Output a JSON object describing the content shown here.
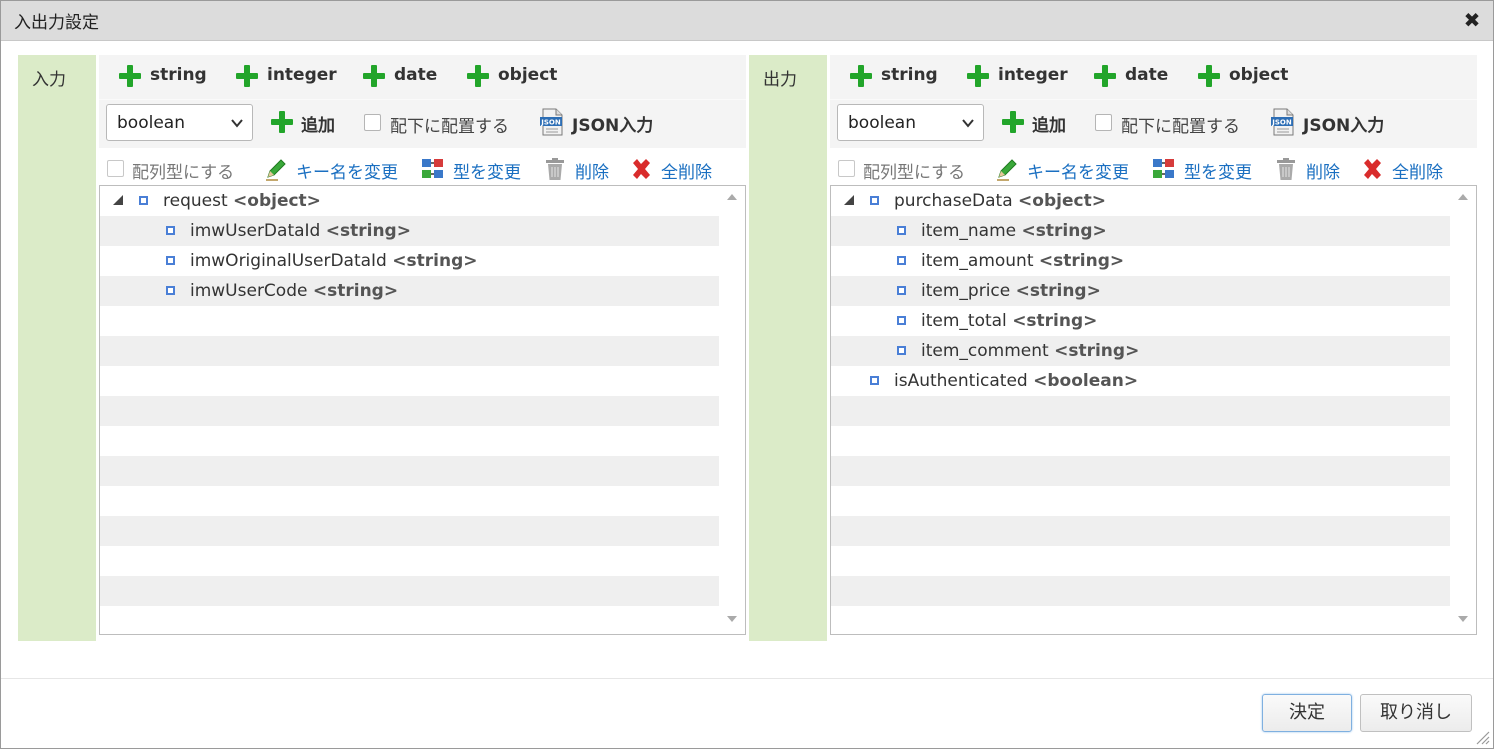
{
  "dialog": {
    "title": "入出力設定"
  },
  "input": {
    "section_label": "入力",
    "type_buttons": [
      "string",
      "integer",
      "date",
      "object"
    ],
    "select_value": "boolean",
    "add_label": "追加",
    "place_under_label": "配下に配置する",
    "json_label": "JSON入力",
    "array_label": "配列型にする",
    "rename_label": "キー名を変更",
    "change_type_label": "型を変更",
    "delete_label": "削除",
    "delete_all_label": "全削除",
    "tree": [
      {
        "name": "request",
        "type": "<object>",
        "level": 0,
        "expanded": true
      },
      {
        "name": "imwUserDataId",
        "type": "<string>",
        "level": 1
      },
      {
        "name": "imwOriginalUserDataId",
        "type": "<string>",
        "level": 1
      },
      {
        "name": "imwUserCode",
        "type": "<string>",
        "level": 1
      }
    ]
  },
  "output": {
    "section_label": "出力",
    "type_buttons": [
      "string",
      "integer",
      "date",
      "object"
    ],
    "select_value": "boolean",
    "add_label": "追加",
    "place_under_label": "配下に配置する",
    "json_label": "JSON入力",
    "array_label": "配列型にする",
    "rename_label": "キー名を変更",
    "change_type_label": "型を変更",
    "delete_label": "削除",
    "delete_all_label": "全削除",
    "tree": [
      {
        "name": "purchaseData",
        "type": "<object>",
        "level": 0,
        "expanded": true
      },
      {
        "name": "item_name",
        "type": "<string>",
        "level": 1
      },
      {
        "name": "item_amount",
        "type": "<string>",
        "level": 1
      },
      {
        "name": "item_price",
        "type": "<string>",
        "level": 1
      },
      {
        "name": "item_total",
        "type": "<string>",
        "level": 1
      },
      {
        "name": "item_comment",
        "type": "<string>",
        "level": 1
      },
      {
        "name": "isAuthenticated",
        "type": "<boolean>",
        "level": 0
      }
    ]
  },
  "footer": {
    "ok_label": "決定",
    "cancel_label": "取り消し"
  },
  "icons": {
    "close": "close-icon",
    "add": "plus-icon",
    "json": "json-file-icon",
    "rename": "pencil-icon",
    "change_type": "blocks-icon",
    "delete": "trash-icon",
    "delete_all": "red-x-icon"
  },
  "colors": {
    "section_bg": "#dbebc8",
    "plus_green": "#22a52a",
    "link_blue": "#1a6fc1",
    "node_blue": "#4a7fd6"
  }
}
